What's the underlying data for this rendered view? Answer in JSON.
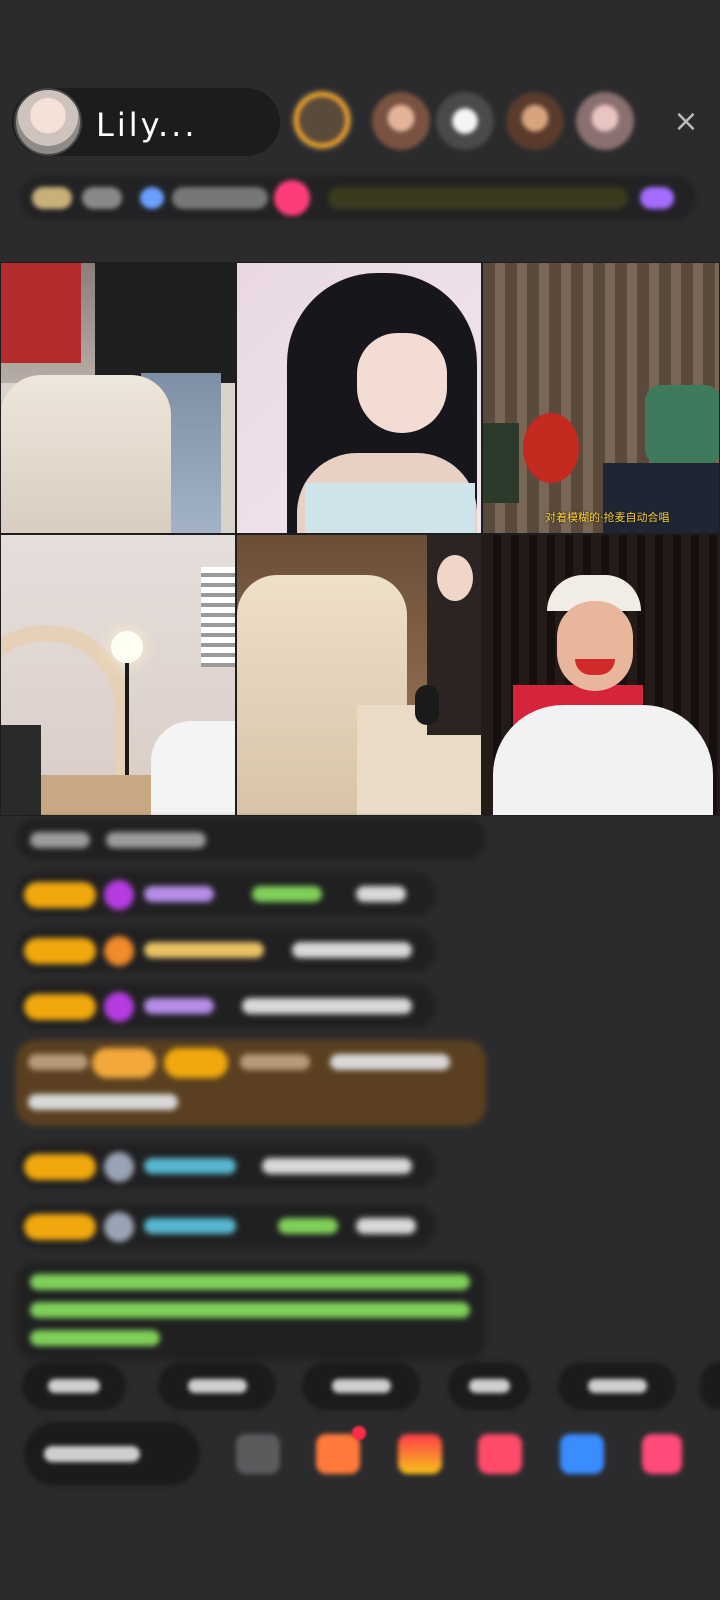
{
  "header": {
    "host_name": "Lily...",
    "close_icon": "×",
    "viewer_avatars": [
      "avatar-1",
      "avatar-2",
      "avatar-3",
      "avatar-4",
      "avatar-5"
    ]
  },
  "video_grid": {
    "tiles": [
      {
        "name": "stream-tile-1"
      },
      {
        "name": "stream-tile-2"
      },
      {
        "name": "stream-tile-3",
        "caption": "对着模糊的·抢麦自动合唱"
      },
      {
        "name": "stream-tile-4"
      },
      {
        "name": "stream-tile-5"
      },
      {
        "name": "stream-tile-6"
      }
    ]
  },
  "colors": {
    "background": "#2b2b2d",
    "badge": "#f0a80d",
    "highlight_row": "#5a4020",
    "green_text": "#7fcf59",
    "accent_pink": "#ff3c7a"
  }
}
